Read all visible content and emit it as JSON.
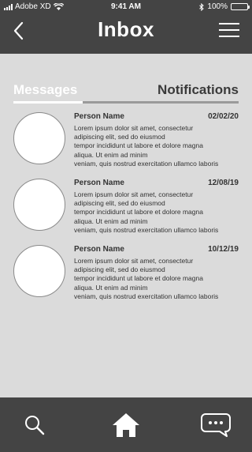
{
  "status_bar": {
    "carrier": "Adobe XD",
    "time": "9:41 AM",
    "battery": "100%",
    "battery_level": 1.0
  },
  "header": {
    "title": "Inbox"
  },
  "tabs": {
    "messages": "Messages",
    "notifications": "Notifications"
  },
  "messages": [
    {
      "name": "Person Name",
      "date": "02/02/20",
      "body": "Lorem ipsum dolor sit amet, consectetur\nadipiscing elit, sed do eiusmod\ntempor incididunt ut labore et dolore magna\naliqua. Ut enim ad minim\nveniam, quis nostrud exercitation ullamco laboris"
    },
    {
      "name": "Person Name",
      "date": "12/08/19",
      "body": "Lorem ipsum dolor sit amet, consectetur\nadipiscing elit, sed do eiusmod\ntempor incididunt ut labore et dolore magna\naliqua. Ut enim ad minim\nveniam, quis nostrud exercitation ullamco laboris"
    },
    {
      "name": "Person Name",
      "date": "10/12/19",
      "body": "Lorem ipsum dolor sit amet, consectetur\nadipiscing elit, sed do eiusmod\ntempor incididunt ut labore et dolore magna\naliqua. Ut enim ad minim\nveniam, quis nostrud exercitation ullamco laboris"
    }
  ],
  "bottom_nav": {
    "icons": [
      "search-icon",
      "home-icon",
      "chat-icon"
    ]
  },
  "colors": {
    "bar": "#444444",
    "background": "#dbdbdb",
    "text": "#333333",
    "active_tab": "#ffffff"
  }
}
